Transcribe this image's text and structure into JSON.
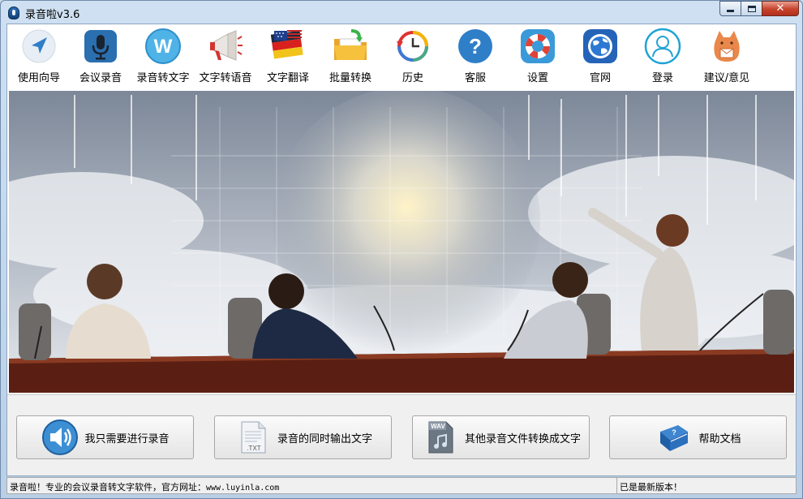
{
  "window": {
    "title": "录音啦v3.6",
    "controls": {
      "minimize": "minimize",
      "maximize": "maximize",
      "close": "close"
    }
  },
  "toolbar": {
    "items": [
      {
        "label": "使用向导",
        "icon": "navigation-arrow-icon"
      },
      {
        "label": "会议录音",
        "icon": "microphone-icon"
      },
      {
        "label": "录音转文字",
        "icon": "w-letter-icon"
      },
      {
        "label": "文字转语音",
        "icon": "megaphone-icon"
      },
      {
        "label": "文字翻译",
        "icon": "flag-translate-icon"
      },
      {
        "label": "批量转换",
        "icon": "folder-icon"
      },
      {
        "label": "历史",
        "icon": "history-clock-icon"
      },
      {
        "label": "客服",
        "icon": "help-question-icon"
      },
      {
        "label": "设置",
        "icon": "lifebuoy-icon"
      },
      {
        "label": "官网",
        "icon": "globe-icon"
      },
      {
        "label": "登录",
        "icon": "user-icon"
      },
      {
        "label": "建议/意见",
        "icon": "cat-mailbox-icon"
      }
    ]
  },
  "actions": [
    {
      "label": "我只需要进行录音",
      "icon": "speaker-icon"
    },
    {
      "label": "录音的同时输出文字",
      "icon": "txt-file-icon"
    },
    {
      "label": "其他录音文件转换成文字",
      "icon": "wav-file-icon"
    },
    {
      "label": "帮助文档",
      "icon": "book-icon"
    }
  ],
  "status": {
    "left_prefix": "录音啦！专业的会议录音转文字软件，官方网址：",
    "left_url": "www.luyinla.com",
    "right": "已是最新版本！"
  },
  "colors": {
    "accent": "#2f7ec8",
    "close_button": "#c7422b",
    "frame": "#c9daec"
  }
}
